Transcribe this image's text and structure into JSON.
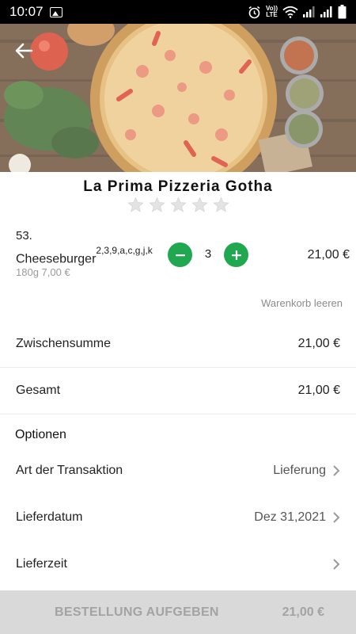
{
  "status_bar": {
    "time": "10:07",
    "volte_top": "Vo))",
    "volte_bottom": "LTE"
  },
  "restaurant": {
    "name": "La Prima Pizzeria Gotha",
    "rating": 0,
    "rating_max": 5
  },
  "item": {
    "number": "53.",
    "name": "Cheeseburger",
    "allergens": "2,3,9,a,c,g,j,k",
    "details": "180g 7,00 €",
    "quantity": "3",
    "price": "21,00 €"
  },
  "clear_cart_label": "Warenkorb leeren",
  "summary": {
    "subtotal_label": "Zwischensumme",
    "subtotal_value": "21,00 €",
    "total_label": "Gesamt",
    "total_value": "21,00 €"
  },
  "options": {
    "title": "Optionen",
    "items": [
      {
        "label": "Art der Transaktion",
        "value": "Lieferung"
      },
      {
        "label": "Lieferdatum",
        "value": "Dez 31,2021"
      },
      {
        "label": "Lieferzeit",
        "value": ""
      }
    ]
  },
  "order_button": {
    "label": "BESTELLUNG AUFGEBEN",
    "price": "21,00 €"
  },
  "colors": {
    "accent_green": "#1fa84f",
    "star_empty": "#e3e3e3",
    "disabled_bar": "#d9d9d9"
  }
}
